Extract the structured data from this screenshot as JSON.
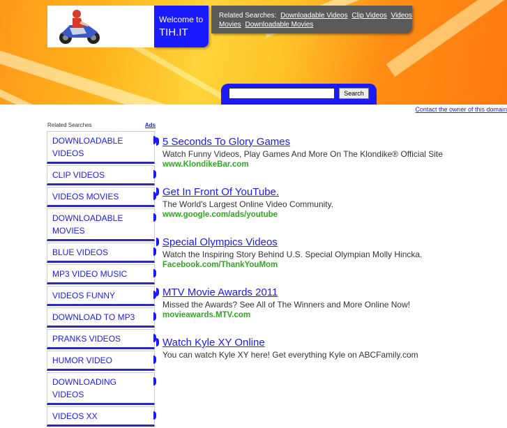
{
  "header": {
    "welcome_line1": "Welcome to",
    "welcome_line2": "TIH.IT",
    "related_label": "Related Searches:",
    "related_links": [
      "Downloadable Videos",
      "Clip Videos",
      "Videos Movies",
      "Downloadable Movies"
    ],
    "search_button": "Search",
    "search_value": ""
  },
  "contact_link": "Contact the owner of this domain",
  "sidebar": {
    "heading": "Related Searches",
    "ads_label": "Ads",
    "items": [
      "DOWNLOADABLE VIDEOS",
      "CLIP VIDEOS",
      "VIDEOS MOVIES",
      "DOWNLOADABLE MOVIES",
      "BLUE VIDEOS",
      "MP3 VIDEO MUSIC",
      "VIDEOS FUNNY",
      "DOWNLOAD TO MP3",
      "PRANKS VIDEOS",
      "HUMOR VIDEO",
      "DOWNLOADING VIDEOS",
      "VIDEOS XX"
    ]
  },
  "results": [
    {
      "title": "5 Seconds To Glory Games",
      "desc": "Watch Funny Videos, Play Games And More On The Klondike® Official Site",
      "url": "www.KlondikeBar.com"
    },
    {
      "title": "Get In Front Of YouTube.",
      "desc": "The World's Largest Online Video Community.",
      "url": "www.google.com/ads/youtube"
    },
    {
      "title": "Special Olympics Videos",
      "desc": "Watch the Inspiring Story Behind U.S. Special Olympian Molly Hincka.",
      "url": "Facebook.com/ThankYouMom"
    },
    {
      "title": "MTV Movie Awards 2011",
      "desc": "Missed the Awards? See All of The Winners and More Online Now!",
      "url": "movieawards.MTV.com"
    },
    {
      "title": "Watch Kyle XY Online",
      "desc": "You can watch Kyle XY here! Get everything Kyle on ABCFamily.com",
      "url": ""
    }
  ],
  "colors": {
    "accent": "#1a1aff",
    "url_green": "#2ea81e",
    "banner_orange": "#ff9a1a"
  }
}
